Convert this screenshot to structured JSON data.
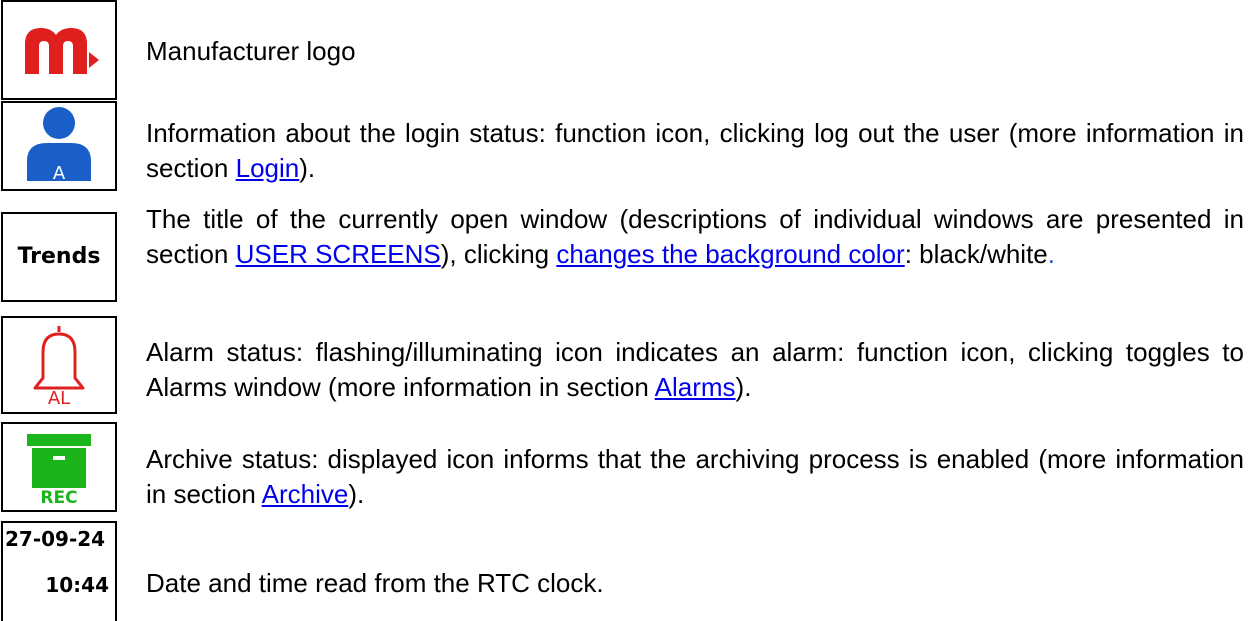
{
  "rows": [
    {
      "icon": "manufacturer-logo-icon",
      "text": "Manufacturer logo"
    },
    {
      "icon": "user-login-icon",
      "icon_label": "A",
      "text_before": "Information about the login status: function icon, clicking log out the user (more information in section ",
      "link": "Login",
      "text_after": ")."
    },
    {
      "icon_label": "Trends",
      "text_before": "The title of the currently open window (descriptions of individual windows are presented in section ",
      "link1": "USER SCREENS",
      "text_mid": "), clicking ",
      "link2": "changes the background color",
      "text_after": ": black/white",
      "dot": "."
    },
    {
      "icon": "bell-alarm-icon",
      "icon_label": "AL",
      "text_before": "Alarm status: flashing/illuminating icon indicates an alarm: function icon, clicking toggles to Alarms window (more information in section ",
      "link": "Alarms",
      "text_after": ")."
    },
    {
      "icon": "archive-box-icon",
      "icon_label": "REC",
      "text_before": "Archive status: displayed icon informs that the archiving process is enabled (more information in section ",
      "link": "Archive",
      "text_after": ")."
    },
    {
      "date": "27-09-24",
      "time": "10:44",
      "text": "Date and time read from the RTC clock."
    }
  ],
  "colors": {
    "logo_red": "#e0201f",
    "user_blue": "#1a5fc8",
    "alarm_red": "#e0201f",
    "archive_green": "#1bb41b",
    "link_blue": "#0000ee"
  }
}
